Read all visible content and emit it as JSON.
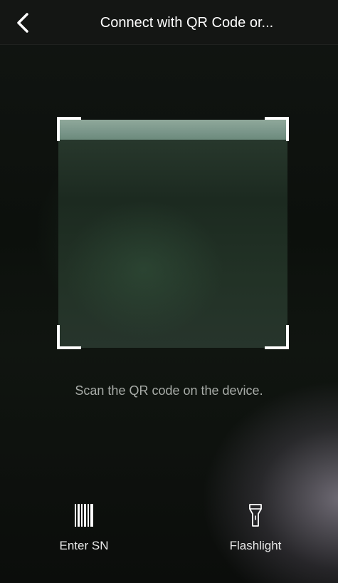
{
  "header": {
    "title": "Connect with QR Code or..."
  },
  "scanner": {
    "hint": "Scan the QR code on the device."
  },
  "actions": {
    "enter_sn_label": "Enter SN",
    "flashlight_label": "Flashlight"
  },
  "icons": {
    "back": "chevron-left-icon",
    "enter_sn": "barcode-icon",
    "flashlight": "flashlight-icon"
  },
  "colors": {
    "accent": "#ffffff",
    "hint_text": "#a8aca8",
    "top_bar": "#141614"
  }
}
